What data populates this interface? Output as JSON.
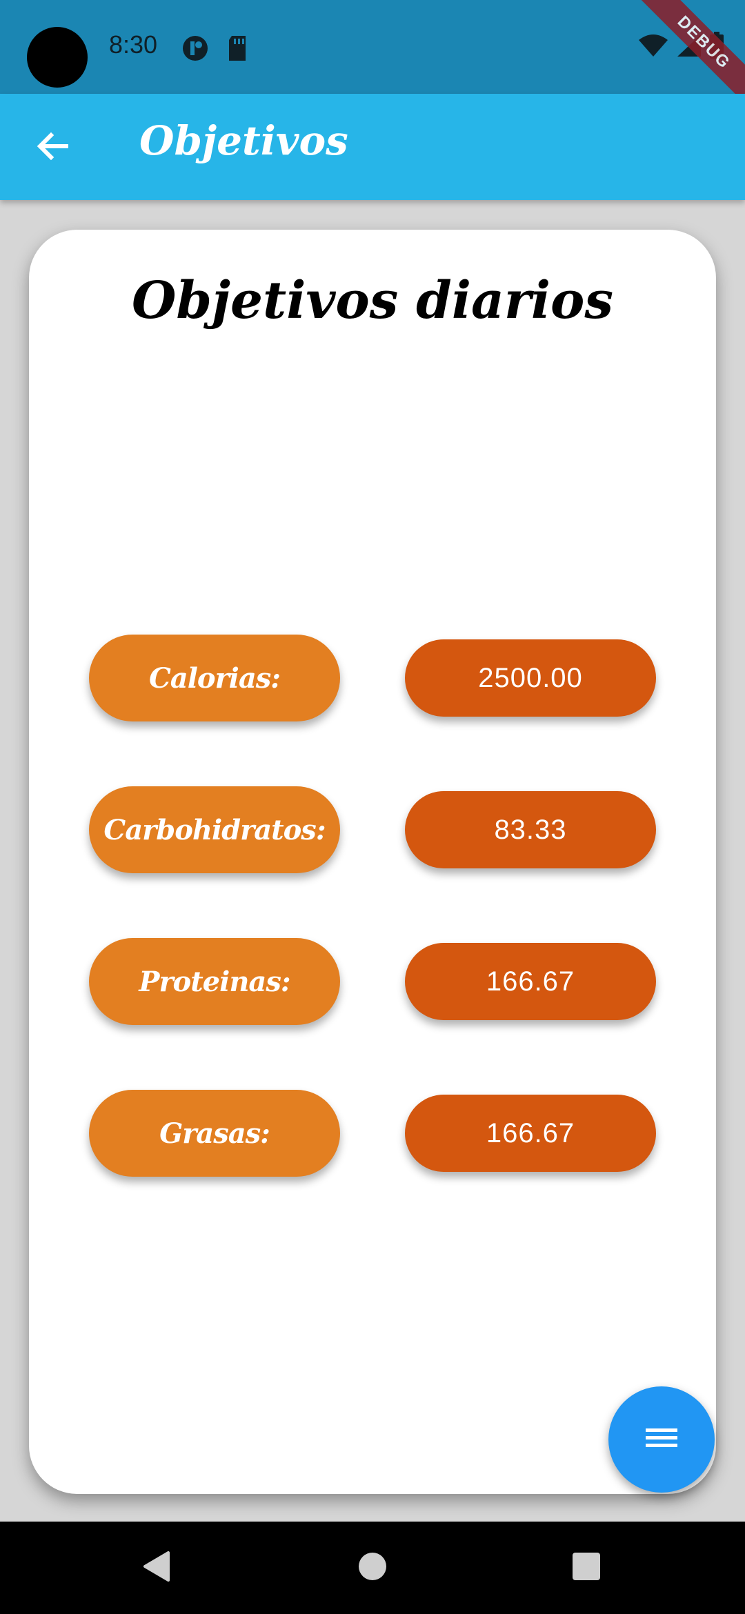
{
  "status_bar": {
    "time": "8:30",
    "debug_label": "DEBUG",
    "color": "#1b86b3"
  },
  "app_bar": {
    "title": "Objetivos",
    "back_icon": "arrow-left-icon",
    "color": "#27b5e8"
  },
  "card": {
    "title": "Objetivos diarios",
    "rows": [
      {
        "label": "Calorias:",
        "value": "2500.00"
      },
      {
        "label": "Carbohidratos:",
        "value": "83.33"
      },
      {
        "label": "Proteinas:",
        "value": "166.67"
      },
      {
        "label": "Grasas:",
        "value": "166.67"
      }
    ],
    "label_color": "#e37f21",
    "value_color": "#d4570f"
  },
  "fab": {
    "icon": "menu-icon",
    "color": "#2196f3"
  },
  "nav_bar": {
    "icons": [
      "back-triangle-icon",
      "home-circle-icon",
      "recents-square-icon"
    ]
  }
}
